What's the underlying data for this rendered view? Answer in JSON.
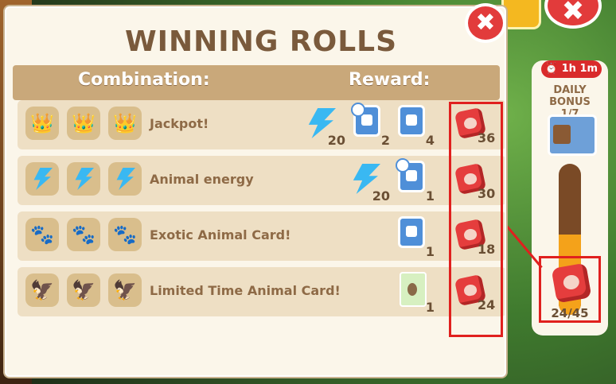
{
  "window": {
    "title": "WINNING ROLLS",
    "close_symbol": "✖"
  },
  "header": {
    "combination": "Combination:",
    "reward": "Reward:"
  },
  "rows": [
    {
      "label": "Jackpot!",
      "symbol": "crown",
      "rewards": [
        {
          "type": "energy",
          "count": "20"
        },
        {
          "type": "card-timer",
          "count": "2"
        },
        {
          "type": "card",
          "count": "4"
        }
      ],
      "dice": "36"
    },
    {
      "label": "Animal energy",
      "symbol": "energy-bolt",
      "rewards": [
        {
          "type": "energy",
          "count": "20"
        },
        {
          "type": "card-timer",
          "count": "1"
        }
      ],
      "dice": "30"
    },
    {
      "label": "Exotic Animal Card!",
      "symbol": "paw",
      "rewards": [
        {
          "type": "card",
          "count": "1"
        }
      ],
      "dice": "18"
    },
    {
      "label": "Limited Time Animal Card!",
      "symbol": "bird",
      "rewards": [
        {
          "type": "egg-card",
          "count": "1"
        }
      ],
      "dice": "24"
    }
  ],
  "bonus": {
    "timer": "1h 1m",
    "title": "DAILY BONUS",
    "day": "1/7",
    "progress_text": "24/45",
    "progress_fraction": 0.533
  },
  "background": {
    "close_symbol": "✖"
  },
  "colors": {
    "accent_red": "#e0201e",
    "panel": "#fbf6ea",
    "header": "#c9a87a",
    "text_brown": "#8e6a46"
  }
}
